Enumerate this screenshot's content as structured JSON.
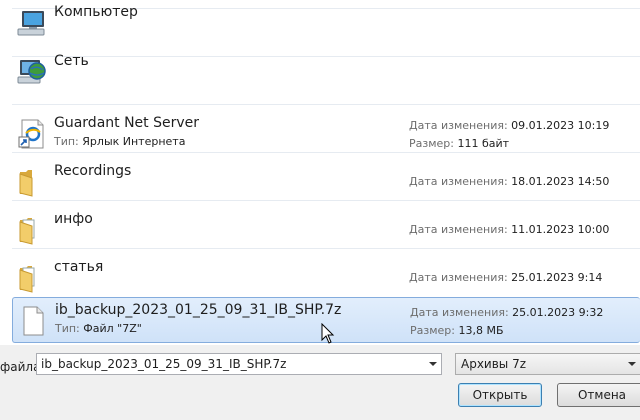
{
  "items": [
    {
      "name": "Компьютер",
      "icon": "computer-icon"
    },
    {
      "name": "Сеть",
      "icon": "network-globe-icon"
    },
    {
      "name": "Guardant Net Server",
      "icon": "internet-shortcut-icon",
      "type_key": "Тип:",
      "type_val": "Ярлык Интернета",
      "date_key": "Дата изменения:",
      "date_val": "09.01.2023 10:19",
      "size_key": "Размер:",
      "size_val": "111 байт"
    },
    {
      "name": "Recordings",
      "icon": "folder-icon",
      "date_key": "Дата изменения:",
      "date_val": "18.01.2023 14:50"
    },
    {
      "name": "инфо",
      "icon": "folder-with-files-icon",
      "date_key": "Дата изменения:",
      "date_val": "11.01.2023 10:00"
    },
    {
      "name": "статья",
      "icon": "folder-with-files-icon",
      "date_key": "Дата изменения:",
      "date_val": "25.01.2023 9:14"
    },
    {
      "name": "ib_backup_2023_01_25_09_31_IB_SHP.7z",
      "icon": "file-icon",
      "type_key": "Тип:",
      "type_val": "Файл \"7Z\"",
      "date_key": "Дата изменения:",
      "date_val": "25.01.2023 9:32",
      "size_key": "Размер:",
      "size_val": "13,8 МБ",
      "selected": true
    }
  ],
  "bottom": {
    "filename_label": "файла:",
    "filename_value": "ib_backup_2023_01_25_09_31_IB_SHP.7z",
    "filter_value": "Архивы 7z",
    "open_label": "Открыть",
    "cancel_label": "Отмена"
  }
}
